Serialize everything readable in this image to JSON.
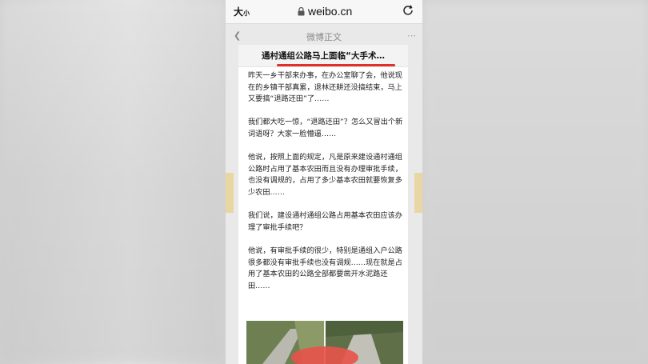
{
  "browser": {
    "text_size_label": "大",
    "text_size_small": "小",
    "domain": "weibo.cn"
  },
  "background_page": {
    "title": "微博正文"
  },
  "article": {
    "title": "通村通组公路马上面临“大手术…",
    "paragraphs": [
      "昨天一乡干部来办事，在办公室聊了会，他说现在的乡镇干部真累，退林还耕还没搞结束，马上又要搞“退路还田”了……",
      "我们都大吃一惊，“退路还田”？怎么又冒出个新词语呀？大家一脸懵逼……",
      "他说，按照上面的规定，凡是原来建设通村通组公路时占用了基本农田而且没有办理审批手续，也没有调规的，占用了多少基本农田就要恢复多少农田……",
      "我们说，建设通村通组公路占用基本农田应该办理了审批手续吧？",
      "他说，有审批手续的很少，特别是通组入户公路很多都没有审批手续也没有调规……现在就是占用了基本农田的公路全部都要凿开水泥路还田……"
    ]
  },
  "icons": {
    "lock": "lock-icon",
    "reload": "reload-icon",
    "back": "chevron-left-icon"
  },
  "colors": {
    "accent_underline": "#e0302a",
    "sticker": "#e8524a"
  }
}
